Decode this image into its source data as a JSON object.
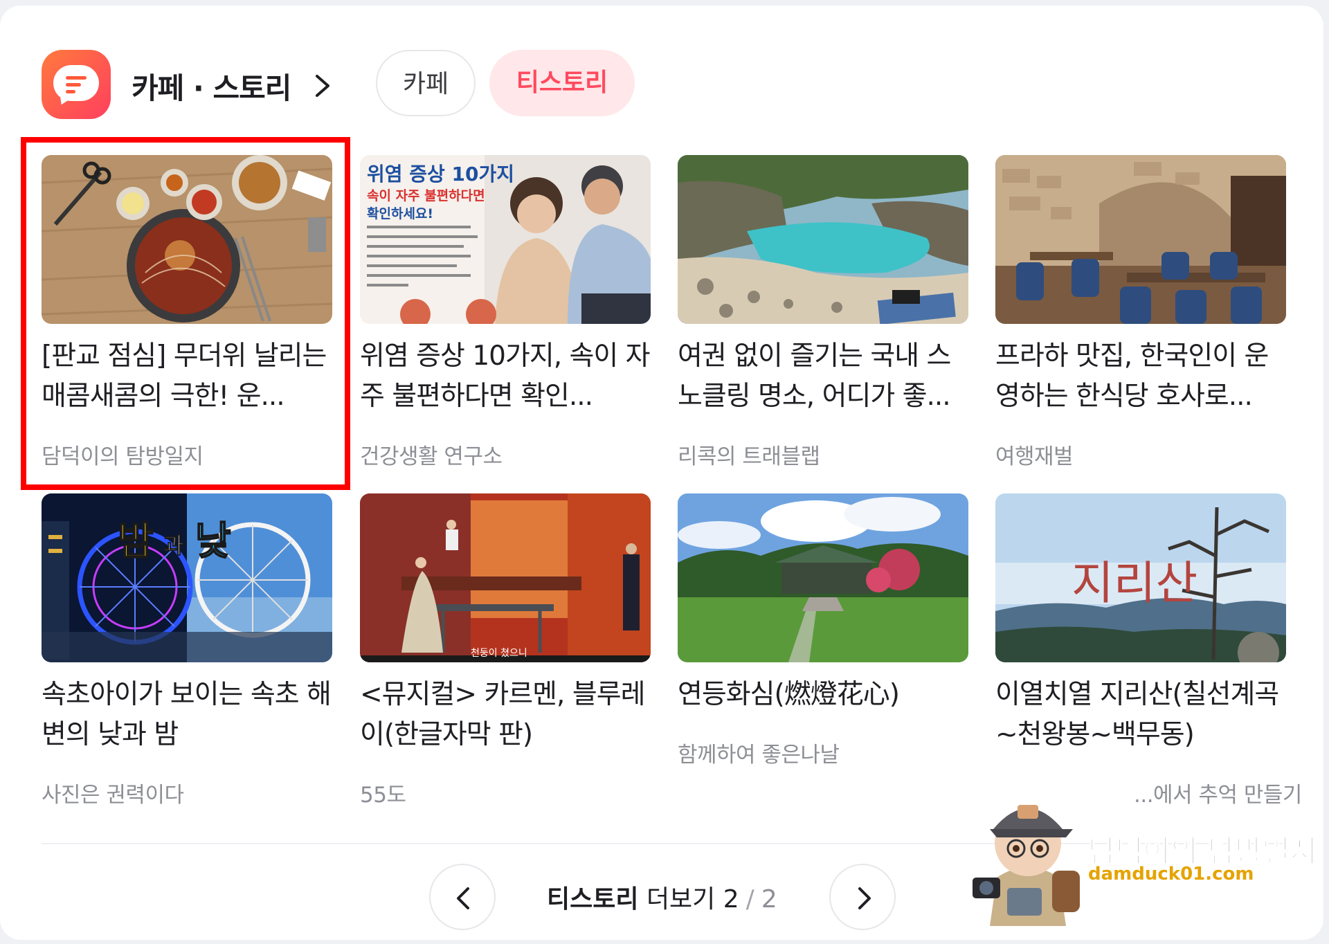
{
  "header": {
    "title": "카페 · 스토리",
    "tabs": [
      {
        "label": "카페",
        "active": false
      },
      {
        "label": "티스토리",
        "active": true
      }
    ]
  },
  "cards": [
    {
      "title": "[판교 점심] 무더위 날리는 매콤새콤의 극한! 운...",
      "source": "담덕이의 탐방일지",
      "thumb": "bibim-naengmyeon-photo"
    },
    {
      "title": "위염 증상 10가지, 속이 자주 불편하다면 확인...",
      "source": "건강생활 연구소",
      "thumb": "gastritis-infographic",
      "thumb_text": {
        "headline": "위염 증상 10가지",
        "sub1": "속이 자주 불편하다면",
        "sub2": "확인하세요!"
      }
    },
    {
      "title": "여권 없이 즐기는 국내 스노클링 명소, 어디가 좋...",
      "source": "리콕의 트래블랩",
      "thumb": "rocky-beach-photo"
    },
    {
      "title": "프라하 맛집, 한국인이 운영하는 한식당 호사로...",
      "source": "여행재벌",
      "thumb": "stone-restaurant-photo"
    },
    {
      "title": "속초아이가 보이는 속초 해변의 낮과 밤",
      "source": "사진은 권력이다",
      "thumb": "ferris-wheel-photo",
      "thumb_text": {
        "big1": "밤",
        "small": "과",
        "big2": "낮"
      }
    },
    {
      "title": "<뮤지컬> 카르멘, 블루레이(한글자막 판)",
      "source": "55도",
      "thumb": "musical-stage-photo",
      "thumb_text": {
        "subtitle": "천둥이 쳤으니"
      }
    },
    {
      "title": "연등화심(燃燈花心)",
      "source": "함께하여 좋은나날",
      "thumb": "temple-garden-photo"
    },
    {
      "title": "이열치열 지리산(칠선계곡~천왕봉~백무동)",
      "source": "...에서 추억 만들기",
      "thumb": "mountain-photo",
      "thumb_text": {
        "calligraphy": "지리산"
      }
    }
  ],
  "pager": {
    "brand": "티스토리",
    "more_label": "더보기",
    "current": "2",
    "separator": "/",
    "total": "2"
  },
  "watermark": {
    "name": "담덕이의 탐방일지",
    "url": "damduck01.com"
  },
  "colors": {
    "accent": "#ff4a5e",
    "accent_bg": "#ffe7ea",
    "highlight": "#ff0000",
    "logo_gradient": [
      "#ff7a3d",
      "#ff3f5e"
    ]
  }
}
